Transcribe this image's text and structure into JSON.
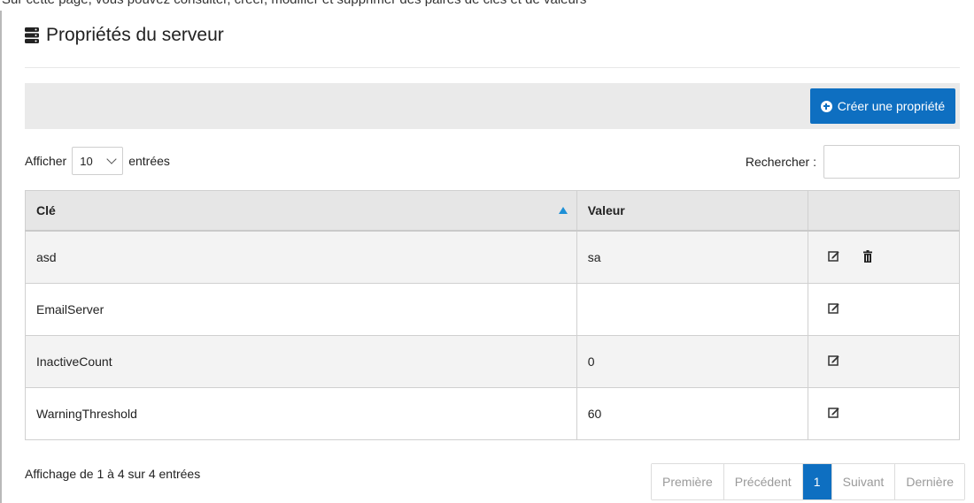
{
  "top_banner": "Sur cette page, vous pouvez consulter, créer, modifier et supprimer des paires de clés et de valeurs",
  "page": {
    "title": "Propriétés du serveur",
    "title_icon": "server-icon"
  },
  "toolbar": {
    "create_label": "Créer une propriété",
    "create_icon": "plus-circle-icon"
  },
  "length": {
    "prefix": "Afficher",
    "value": "10",
    "suffix": "entrées"
  },
  "search": {
    "label": "Rechercher :",
    "value": "",
    "placeholder": ""
  },
  "table": {
    "columns": [
      "Clé",
      "Valeur",
      ""
    ],
    "sort": {
      "column": "Clé",
      "direction": "asc"
    },
    "rows": [
      {
        "key": "asd",
        "value": "sa",
        "actions": [
          "edit-icon",
          "delete-icon"
        ]
      },
      {
        "key": "EmailServer",
        "value": "",
        "actions": [
          "edit-icon"
        ]
      },
      {
        "key": "InactiveCount",
        "value": "0",
        "actions": [
          "edit-icon"
        ]
      },
      {
        "key": "WarningThreshold",
        "value": "60",
        "actions": [
          "edit-icon"
        ]
      }
    ]
  },
  "footer": {
    "info": "Affichage de 1 à 4 sur 4 entrées"
  },
  "pagination": {
    "items": [
      "Première",
      "Précédent",
      "1",
      "Suivant",
      "Dernière"
    ],
    "active": "1"
  },
  "colors": {
    "primary": "#0e6fc1",
    "sort_indicator": "#1e90d6",
    "header_bg": "#e6e6e6",
    "toolbar_bg": "#eaeaea"
  }
}
